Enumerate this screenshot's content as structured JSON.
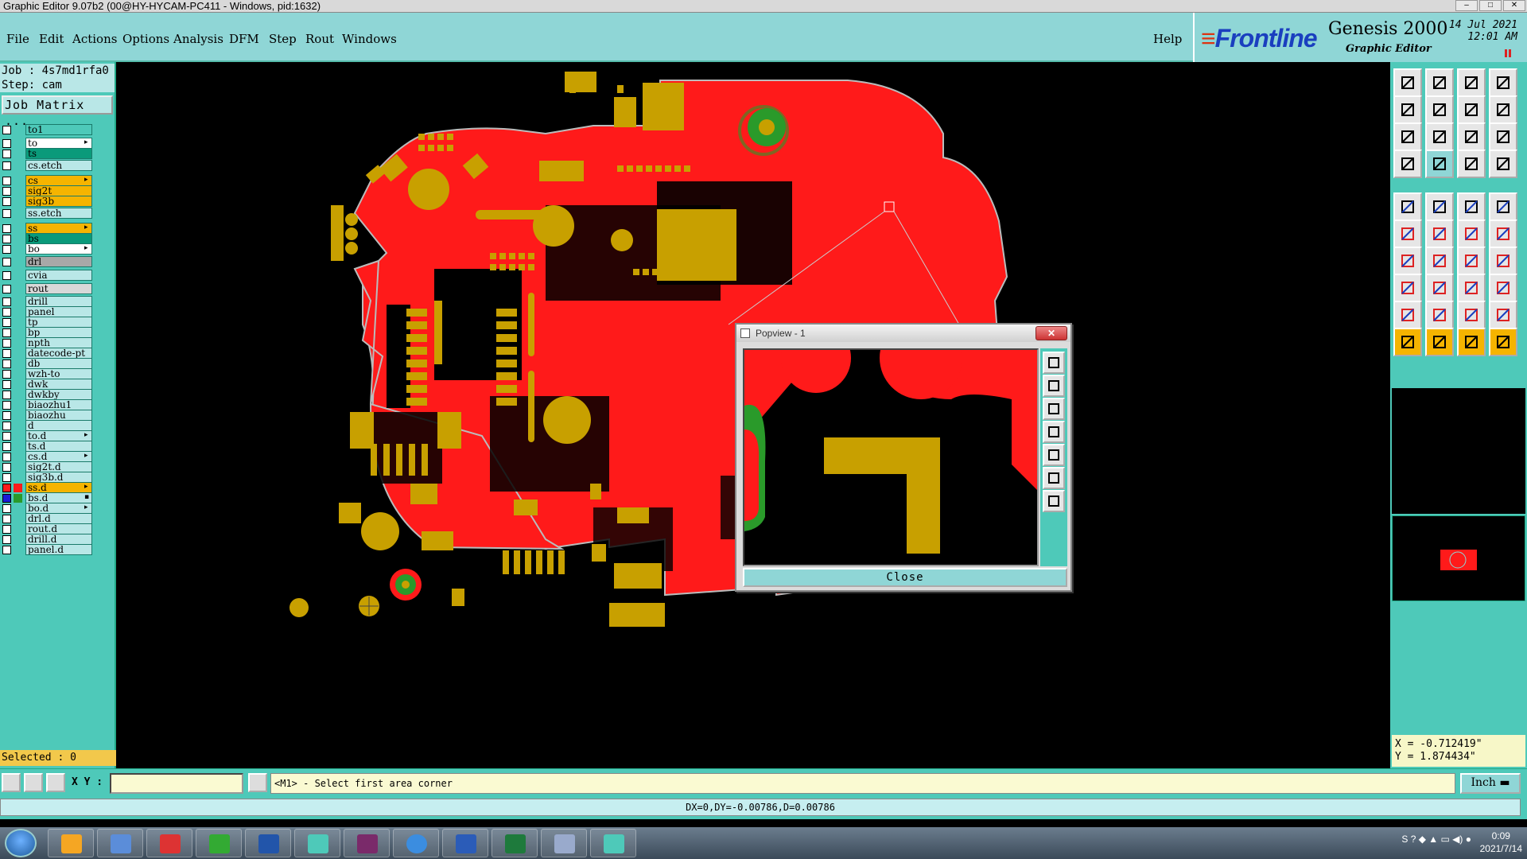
{
  "window": {
    "title": "Graphic Editor 9.07b2 (00@HY-HYCAM-PC411 - Windows, pid:1632)"
  },
  "menu": {
    "items": [
      "File",
      "Edit",
      "Actions",
      "Options",
      "Analysis",
      "DFM",
      "Step",
      "Rout",
      "Windows"
    ],
    "help": "Help"
  },
  "brand": {
    "logo": "Frontline",
    "product": "Genesis 2000",
    "subtitle": "Graphic Editor",
    "date": "14 Jul 2021",
    "time": "12:01 AM"
  },
  "job": {
    "job_line": "Job : 4s7md1rfa0",
    "step_line": "Step: cam",
    "matrix_button": "Job Matrix ..."
  },
  "layers": [
    {
      "name": "to1",
      "color": "#4ec9b9",
      "cb": "white",
      "arrow": ""
    },
    {
      "name": "to",
      "color": "#ffffff",
      "cb": "white",
      "arrow": "▸"
    },
    {
      "name": "ts",
      "color": "#0a9a7a",
      "cb": "white",
      "arrow": ""
    },
    {
      "name": "cs.etch",
      "color": "#b9e7e7",
      "cb": "white",
      "arrow": ""
    },
    {
      "name": "cs",
      "color": "#f5b400",
      "cb": "white",
      "arrow": "▸"
    },
    {
      "name": "sig2t",
      "color": "#f5b400",
      "cb": "white",
      "arrow": ""
    },
    {
      "name": "sig3b",
      "color": "#f5b400",
      "cb": "white",
      "arrow": ""
    },
    {
      "name": "ss.etch",
      "color": "#b9e7e7",
      "cb": "white",
      "arrow": ""
    },
    {
      "name": "ss",
      "color": "#f5b400",
      "cb": "white",
      "arrow": "▸"
    },
    {
      "name": "bs",
      "color": "#0a9a7a",
      "cb": "white",
      "arrow": ""
    },
    {
      "name": "bo",
      "color": "#ffffff",
      "cb": "white",
      "arrow": "▸"
    },
    {
      "name": "drl",
      "color": "#a8a8a8",
      "cb": "white",
      "arrow": ""
    },
    {
      "name": "cvia",
      "color": "#b9e7e7",
      "cb": "white",
      "arrow": ""
    },
    {
      "name": "rout",
      "color": "#d8d8d8",
      "cb": "white",
      "arrow": ""
    },
    {
      "name": "drill",
      "color": "#b9e7e7",
      "cb": "white",
      "arrow": ""
    },
    {
      "name": "panel",
      "color": "#b9e7e7",
      "cb": "white",
      "arrow": ""
    },
    {
      "name": "tp",
      "color": "#b9e7e7",
      "cb": "white",
      "arrow": ""
    },
    {
      "name": "bp",
      "color": "#b9e7e7",
      "cb": "white",
      "arrow": ""
    },
    {
      "name": "npth",
      "color": "#b9e7e7",
      "cb": "white",
      "arrow": ""
    },
    {
      "name": "datecode-pt",
      "color": "#b9e7e7",
      "cb": "white",
      "arrow": ""
    },
    {
      "name": "db",
      "color": "#b9e7e7",
      "cb": "white",
      "arrow": ""
    },
    {
      "name": "wzh-to",
      "color": "#b9e7e7",
      "cb": "white",
      "arrow": ""
    },
    {
      "name": "dwk",
      "color": "#b9e7e7",
      "cb": "white",
      "arrow": ""
    },
    {
      "name": "dwkby",
      "color": "#b9e7e7",
      "cb": "white",
      "arrow": ""
    },
    {
      "name": "biaozhu1",
      "color": "#b9e7e7",
      "cb": "white",
      "arrow": ""
    },
    {
      "name": "biaozhu",
      "color": "#b9e7e7",
      "cb": "white",
      "arrow": ""
    },
    {
      "name": "d",
      "color": "#b9e7e7",
      "cb": "white",
      "arrow": ""
    },
    {
      "name": "to.d",
      "color": "#b9e7e7",
      "cb": "white",
      "arrow": "▸"
    },
    {
      "name": "ts.d",
      "color": "#b9e7e7",
      "cb": "white",
      "arrow": ""
    },
    {
      "name": "cs.d",
      "color": "#b9e7e7",
      "cb": "white",
      "arrow": "▸"
    },
    {
      "name": "sig2t.d",
      "color": "#b9e7e7",
      "cb": "white",
      "arrow": ""
    },
    {
      "name": "sig3b.d",
      "color": "#b9e7e7",
      "cb": "white",
      "arrow": ""
    },
    {
      "name": "ss.d",
      "color": "#f5b400",
      "cb": "red",
      "arrow": "▸"
    },
    {
      "name": "bs.d",
      "color": "#b9e7e7",
      "cb": "blue",
      "arrow": "▪"
    },
    {
      "name": "bo.d",
      "color": "#b9e7e7",
      "cb": "white",
      "arrow": "▸"
    },
    {
      "name": "drl.d",
      "color": "#b9e7e7",
      "cb": "white",
      "arrow": ""
    },
    {
      "name": "rout.d",
      "color": "#b9e7e7",
      "cb": "white",
      "arrow": ""
    },
    {
      "name": "drill.d",
      "color": "#b9e7e7",
      "cb": "white",
      "arrow": ""
    },
    {
      "name": "panel.d",
      "color": "#b9e7e7",
      "cb": "white",
      "arrow": ""
    }
  ],
  "selected": "Selected : 0",
  "coords": {
    "x": "X = -0.712419\"",
    "y": "Y = 1.874434\""
  },
  "command": {
    "xy_label": "X Y :",
    "xy_value": "",
    "prompt": "<M1> - Select first area corner",
    "units": "Inch"
  },
  "status": "DX=0,DY=-0.00786,D=0.00786",
  "popview": {
    "title": "Popview - 1",
    "close_label": "Close"
  },
  "taskbar": {
    "time": "0:09",
    "date": "2021/7/14"
  },
  "colors": {
    "copper": "#ff1a1a",
    "pad": "#c8a000",
    "panel": "#4ec9b9",
    "menu": "#8fd6d6"
  }
}
